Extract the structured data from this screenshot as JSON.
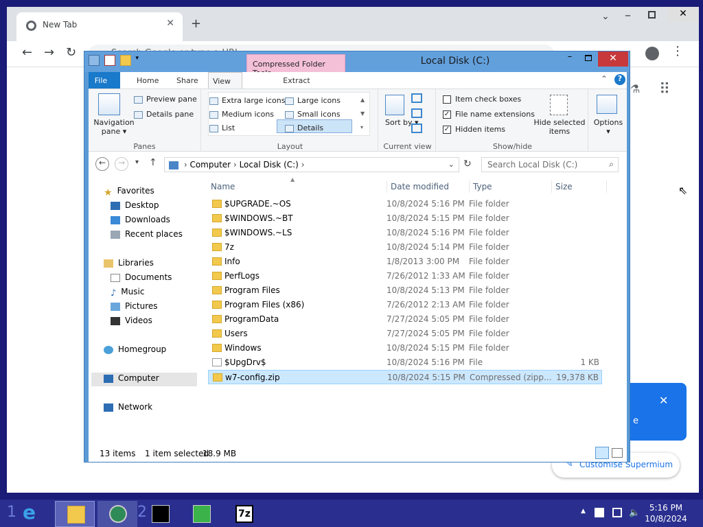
{
  "browser": {
    "tab_title": "New Tab",
    "omnibox_placeholder": "Search Google or type a URL",
    "promo_text": "e",
    "customise_label": "Customise Supermium",
    "new_tab_symbol": "+",
    "close_symbol": "✕"
  },
  "explorer": {
    "title": "Local Disk (C:)",
    "contextual_tab": "Compressed Folder Tools",
    "tabs": [
      "File",
      "Home",
      "Share",
      "View",
      "Extract"
    ],
    "ribbon": {
      "panes": {
        "nav_pane": "Navigation pane",
        "preview": "Preview pane",
        "details": "Details pane",
        "label": "Panes"
      },
      "layout": {
        "items": [
          "Extra large icons",
          "Large icons",
          "Medium icons",
          "Small icons",
          "List",
          "Details"
        ],
        "selected": "Details",
        "label": "Layout"
      },
      "current_view": {
        "sort": "Sort by",
        "label": "Current view"
      },
      "show_hide": {
        "item_check_boxes": "Item check boxes",
        "file_name_extensions": "File name extensions",
        "hidden_items": "Hidden items",
        "hide_selected": "Hide selected items",
        "label": "Show/hide",
        "checks": [
          false,
          true,
          true
        ]
      },
      "options": "Options"
    },
    "address": {
      "crumbs": [
        "Computer",
        "Local Disk (C:)"
      ],
      "search_placeholder": "Search Local Disk (C:)"
    },
    "nav": {
      "favorites": "Favorites",
      "desktop": "Desktop",
      "downloads": "Downloads",
      "recent": "Recent places",
      "libraries": "Libraries",
      "documents": "Documents",
      "music": "Music",
      "pictures": "Pictures",
      "videos": "Videos",
      "homegroup": "Homegroup",
      "computer": "Computer",
      "network": "Network"
    },
    "columns": [
      "Name",
      "Date modified",
      "Type",
      "Size"
    ],
    "files": [
      {
        "name": "$UPGRADE.~OS",
        "date": "10/8/2024 5:16 PM",
        "type": "File folder",
        "size": "",
        "kind": "folder"
      },
      {
        "name": "$WINDOWS.~BT",
        "date": "10/8/2024 5:15 PM",
        "type": "File folder",
        "size": "",
        "kind": "folder"
      },
      {
        "name": "$WINDOWS.~LS",
        "date": "10/8/2024 5:16 PM",
        "type": "File folder",
        "size": "",
        "kind": "folder"
      },
      {
        "name": "7z",
        "date": "10/8/2024 5:14 PM",
        "type": "File folder",
        "size": "",
        "kind": "folder"
      },
      {
        "name": "Info",
        "date": "1/8/2013 3:00 PM",
        "type": "File folder",
        "size": "",
        "kind": "folder"
      },
      {
        "name": "PerfLogs",
        "date": "7/26/2012 1:33 AM",
        "type": "File folder",
        "size": "",
        "kind": "folder"
      },
      {
        "name": "Program Files",
        "date": "10/8/2024 5:13 PM",
        "type": "File folder",
        "size": "",
        "kind": "folder"
      },
      {
        "name": "Program Files (x86)",
        "date": "7/26/2012 2:13 AM",
        "type": "File folder",
        "size": "",
        "kind": "folder"
      },
      {
        "name": "ProgramData",
        "date": "7/27/2024 5:05 PM",
        "type": "File folder",
        "size": "",
        "kind": "folder"
      },
      {
        "name": "Users",
        "date": "7/27/2024 5:05 PM",
        "type": "File folder",
        "size": "",
        "kind": "folder"
      },
      {
        "name": "Windows",
        "date": "10/8/2024 5:15 PM",
        "type": "File folder",
        "size": "",
        "kind": "folder"
      },
      {
        "name": "$UpgDrv$",
        "date": "10/8/2024 5:16 PM",
        "type": "File",
        "size": "1 KB",
        "kind": "file"
      },
      {
        "name": "w7-config.zip",
        "date": "10/8/2024 5:15 PM",
        "type": "Compressed (zipp...",
        "size": "19,378 KB",
        "kind": "zip",
        "selected": true
      }
    ],
    "status": {
      "count": "13 items",
      "selection": "1 item selected",
      "size": "18.9 MB"
    }
  },
  "taskbar": {
    "time": "5:16 PM",
    "date": "10/8/2024",
    "numbers": [
      "1",
      "2"
    ]
  },
  "colors": {
    "selection": "#cce8ff",
    "file_tab": "#1979ca",
    "context_tab": "#f4c0d8",
    "taskbar": "#2a2f8f",
    "close": "#c7393b"
  }
}
